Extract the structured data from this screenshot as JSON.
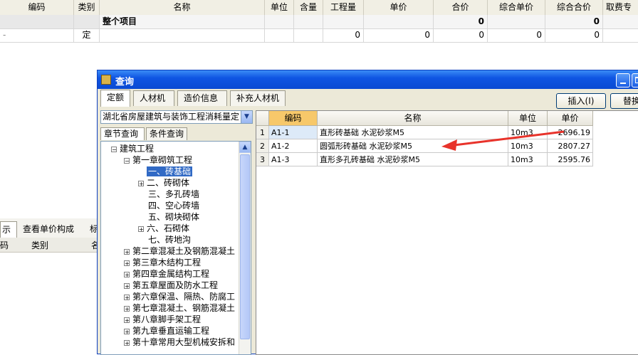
{
  "background": {
    "columns": [
      "编码",
      "类别",
      "名称",
      "单位",
      "含量",
      "工程量",
      "单价",
      "合价",
      "综合单价",
      "综合合价",
      "取费专"
    ],
    "project_row": {
      "name": "整个项目",
      "total": "0",
      "total2": "0"
    },
    "item_row": {
      "type": "定",
      "qty": "0",
      "price": "0",
      "sum": "0",
      "unit_price": "0",
      "unit_sum": "0"
    },
    "lower_tabs": [
      "示",
      "查看单价构成",
      "标"
    ],
    "lower_head": [
      "码",
      "类别",
      "名"
    ]
  },
  "dialog": {
    "title": "查询",
    "tabs": [
      "定额",
      "人材机",
      "造价信息",
      "补充人材机"
    ],
    "buttons": {
      "insert": "插入(I)",
      "replace": "替换"
    },
    "quota_library": "湖北省房屋建筑与装饰工程消耗量定",
    "query_tabs": [
      "章节查询",
      "条件查询"
    ],
    "tree": [
      {
        "indent": 0,
        "toggle": "-",
        "label": "建筑工程"
      },
      {
        "indent": 1,
        "toggle": "-",
        "label": "第一章砌筑工程"
      },
      {
        "indent": 2,
        "toggle": "",
        "label": "一、砖基础",
        "selected": true
      },
      {
        "indent": 2,
        "toggle": "+",
        "label": "二、砖砌体"
      },
      {
        "indent": 2,
        "toggle": "",
        "label": "三、多孔砖墙"
      },
      {
        "indent": 2,
        "toggle": "",
        "label": "四、空心砖墙"
      },
      {
        "indent": 2,
        "toggle": "",
        "label": "五、砌块砌体"
      },
      {
        "indent": 2,
        "toggle": "+",
        "label": "六、石砌体"
      },
      {
        "indent": 2,
        "toggle": "",
        "label": "七、砖地沟"
      },
      {
        "indent": 1,
        "toggle": "+",
        "label": "第二章混凝土及钢筋混凝土"
      },
      {
        "indent": 1,
        "toggle": "+",
        "label": "第三章木结构工程"
      },
      {
        "indent": 1,
        "toggle": "+",
        "label": "第四章金属结构工程"
      },
      {
        "indent": 1,
        "toggle": "+",
        "label": "第五章屋面及防水工程"
      },
      {
        "indent": 1,
        "toggle": "+",
        "label": "第六章保温、隔热、防腐工"
      },
      {
        "indent": 1,
        "toggle": "+",
        "label": "第七章混凝土、钢筋混凝土"
      },
      {
        "indent": 1,
        "toggle": "+",
        "label": "第八章脚手架工程"
      },
      {
        "indent": 1,
        "toggle": "+",
        "label": "第九章垂直运输工程"
      },
      {
        "indent": 1,
        "toggle": "+",
        "label": "第十章常用大型机械安拆和"
      }
    ],
    "grid": {
      "headers": [
        "",
        "编码",
        "名称",
        "单位",
        "单价"
      ],
      "rows": [
        {
          "no": "1",
          "code": "A1-1",
          "name": "直形砖基础 水泥砂浆M5",
          "unit": "10m3",
          "price": "2696.19"
        },
        {
          "no": "2",
          "code": "A1-2",
          "name": "圆弧形砖基础 水泥砂浆M5",
          "unit": "10m3",
          "price": "2807.27"
        },
        {
          "no": "3",
          "code": "A1-3",
          "name": "直形多孔砖基础 水泥砂浆M5",
          "unit": "10m3",
          "price": "2595.76"
        }
      ]
    }
  }
}
